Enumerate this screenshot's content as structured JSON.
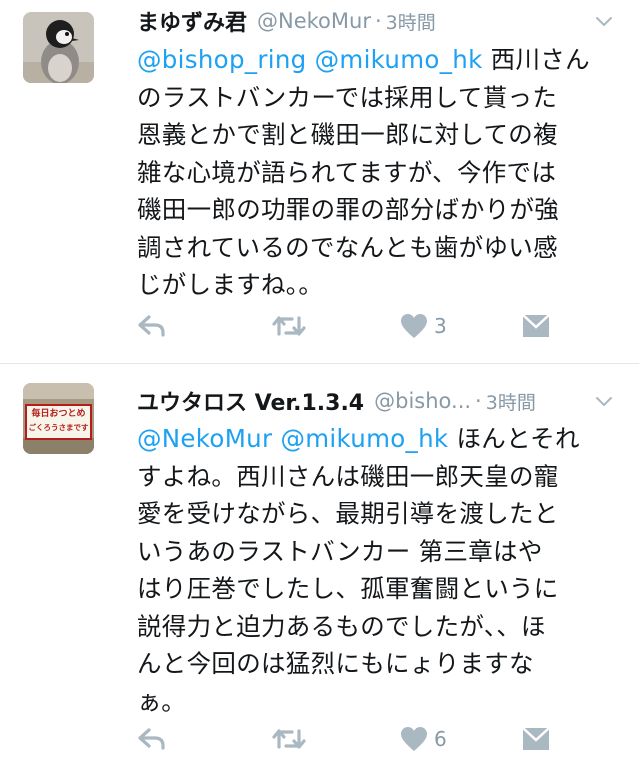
{
  "tweets": [
    {
      "name": "まゆずみ君",
      "handle": "@NekoMur",
      "dot": "·",
      "time": "3時間",
      "lines": [
        {
          "m1": "@bishop_ring",
          "m2": "@mikumo_hk",
          "t": " 西川さん"
        },
        {
          "t": "のラストバンカーでは採用して貰った"
        },
        {
          "t": "恩義とかで割と磯田一郎に対しての複"
        },
        {
          "t": "雑な心境が語られてますが、今作では"
        },
        {
          "t": "磯田一郎の功罪の罪の部分ばかりが強"
        },
        {
          "t": "調されているのでなんとも歯がゆい感"
        },
        {
          "t": "じがしますね。。"
        }
      ],
      "like_count": "3"
    },
    {
      "name": "ユウタロス Ver.1.3.4",
      "handle": "@bisho...",
      "dot": "·",
      "time": "3時間",
      "avatar_sign_line1": "毎日おつとめ",
      "avatar_sign_line2": "ごくろうさまです",
      "lines": [
        {
          "m1": "@NekoMur",
          "m2": "@mikumo_hk",
          "t": " ほんとそれ"
        },
        {
          "t": "すよね。西川さんは磯田一郎天皇の寵"
        },
        {
          "t": "愛を受けながら、最期引導を渡したと"
        },
        {
          "t": "いうあのラストバンカー 第三章はや"
        },
        {
          "t": "はり圧巻でしたし、孤軍奮闘というに"
        },
        {
          "t": "説得力と迫力あるものでしたが、、ほ"
        },
        {
          "t": "んと今回のは猛烈にもにょりますな"
        },
        {
          "t": "ぁ。"
        }
      ],
      "like_count": "6"
    }
  ],
  "colors": {
    "link": "#1da1f2",
    "meta": "#8899a6",
    "icon": "#aab8c2",
    "text": "#14171a",
    "divider": "#e1e8ed"
  },
  "icons": [
    "reply-icon",
    "retweet-icon",
    "heart-icon",
    "direct-message-icon",
    "chevron-down-icon"
  ]
}
